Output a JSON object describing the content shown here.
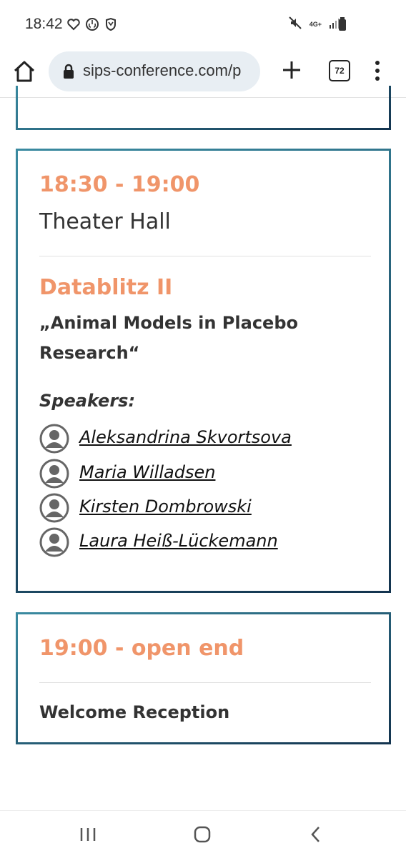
{
  "status_bar": {
    "time": "18:42",
    "network": "4G+"
  },
  "browser": {
    "url": "sips-conference.com/p",
    "tab_count": "72"
  },
  "session": {
    "time": "18:30 - 19:00",
    "location": "Theater Hall",
    "title": "Datablitz II",
    "subtitle": "„Animal Models in Placebo Research“",
    "speakers_label": "Speakers:",
    "speakers": [
      {
        "name": "Aleksandrina Skvortsova"
      },
      {
        "name": "Maria Willadsen"
      },
      {
        "name": "Kirsten Dombrowski"
      },
      {
        "name": "Laura Heiß-Lückemann"
      }
    ]
  },
  "next_session": {
    "time": "19:00 - open end",
    "title": "Welcome Reception"
  },
  "colors": {
    "accent": "#f0956a",
    "border": "#1a5a7a"
  }
}
